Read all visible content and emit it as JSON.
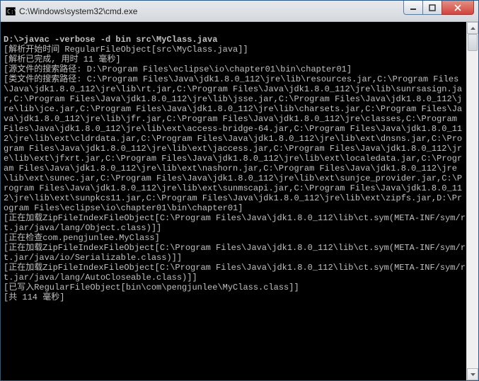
{
  "window": {
    "title": "C:\\Windows\\system32\\cmd.exe"
  },
  "console": {
    "lines": [
      "",
      "D:\\>javac -verbose -d bin src\\MyClass.java",
      "[解析开始时间 RegularFileObject[src\\MyClass.java]]",
      "[解析已完成, 用时 11 毫秒]",
      "[源文件的搜索路径: D:\\Program Files\\eclipse\\io\\chapter01\\bin\\chapter01]",
      "[类文件的搜索路径: C:\\Program Files\\Java\\jdk1.8.0_112\\jre\\lib\\resources.jar,C:\\Program Files\\Java\\jdk1.8.0_112\\jre\\lib\\rt.jar,C:\\Program Files\\Java\\jdk1.8.0_112\\jre\\lib\\sunrsasign.jar,C:\\Program Files\\Java\\jdk1.8.0_112\\jre\\lib\\jsse.jar,C:\\Program Files\\Java\\jdk1.8.0_112\\jre\\lib\\jce.jar,C:\\Program Files\\Java\\jdk1.8.0_112\\jre\\lib\\charsets.jar,C:\\Program Files\\Java\\jdk1.8.0_112\\jre\\lib\\jfr.jar,C:\\Program Files\\Java\\jdk1.8.0_112\\jre\\classes,C:\\Program Files\\Java\\jdk1.8.0_112\\jre\\lib\\ext\\access-bridge-64.jar,C:\\Program Files\\Java\\jdk1.8.0_112\\jre\\lib\\ext\\cldrdata.jar,C:\\Program Files\\Java\\jdk1.8.0_112\\jre\\lib\\ext\\dnsns.jar,C:\\Program Files\\Java\\jdk1.8.0_112\\jre\\lib\\ext\\jaccess.jar,C:\\Program Files\\Java\\jdk1.8.0_112\\jre\\lib\\ext\\jfxrt.jar,C:\\Program Files\\Java\\jdk1.8.0_112\\jre\\lib\\ext\\localedata.jar,C:\\Program Files\\Java\\jdk1.8.0_112\\jre\\lib\\ext\\nashorn.jar,C:\\Program Files\\Java\\jdk1.8.0_112\\jre\\lib\\ext\\sunec.jar,C:\\Program Files\\Java\\jdk1.8.0_112\\jre\\lib\\ext\\sunjce_provider.jar,C:\\Program Files\\Java\\jdk1.8.0_112\\jre\\lib\\ext\\sunmscapi.jar,C:\\Program Files\\Java\\jdk1.8.0_112\\jre\\lib\\ext\\sunpkcs11.jar,C:\\Program Files\\Java\\jdk1.8.0_112\\jre\\lib\\ext\\zipfs.jar,D:\\Program Files\\eclipse\\io\\chapter01\\bin\\chapter01]",
      "[正在加载ZipFileIndexFileObject[C:\\Program Files\\Java\\jdk1.8.0_112\\lib\\ct.sym(META-INF/sym/rt.jar/java/lang/Object.class)]]",
      "[正在检查com.pengjunlee.MyClass]",
      "[正在加载ZipFileIndexFileObject[C:\\Program Files\\Java\\jdk1.8.0_112\\lib\\ct.sym(META-INF/sym/rt.jar/java/io/Serializable.class)]]",
      "[正在加载ZipFileIndexFileObject[C:\\Program Files\\Java\\jdk1.8.0_112\\lib\\ct.sym(META-INF/sym/rt.jar/java/lang/AutoCloseable.class)]]",
      "[已写入RegularFileObject[bin\\com\\pengjunlee\\MyClass.class]]",
      "[共 114 毫秒]"
    ]
  }
}
